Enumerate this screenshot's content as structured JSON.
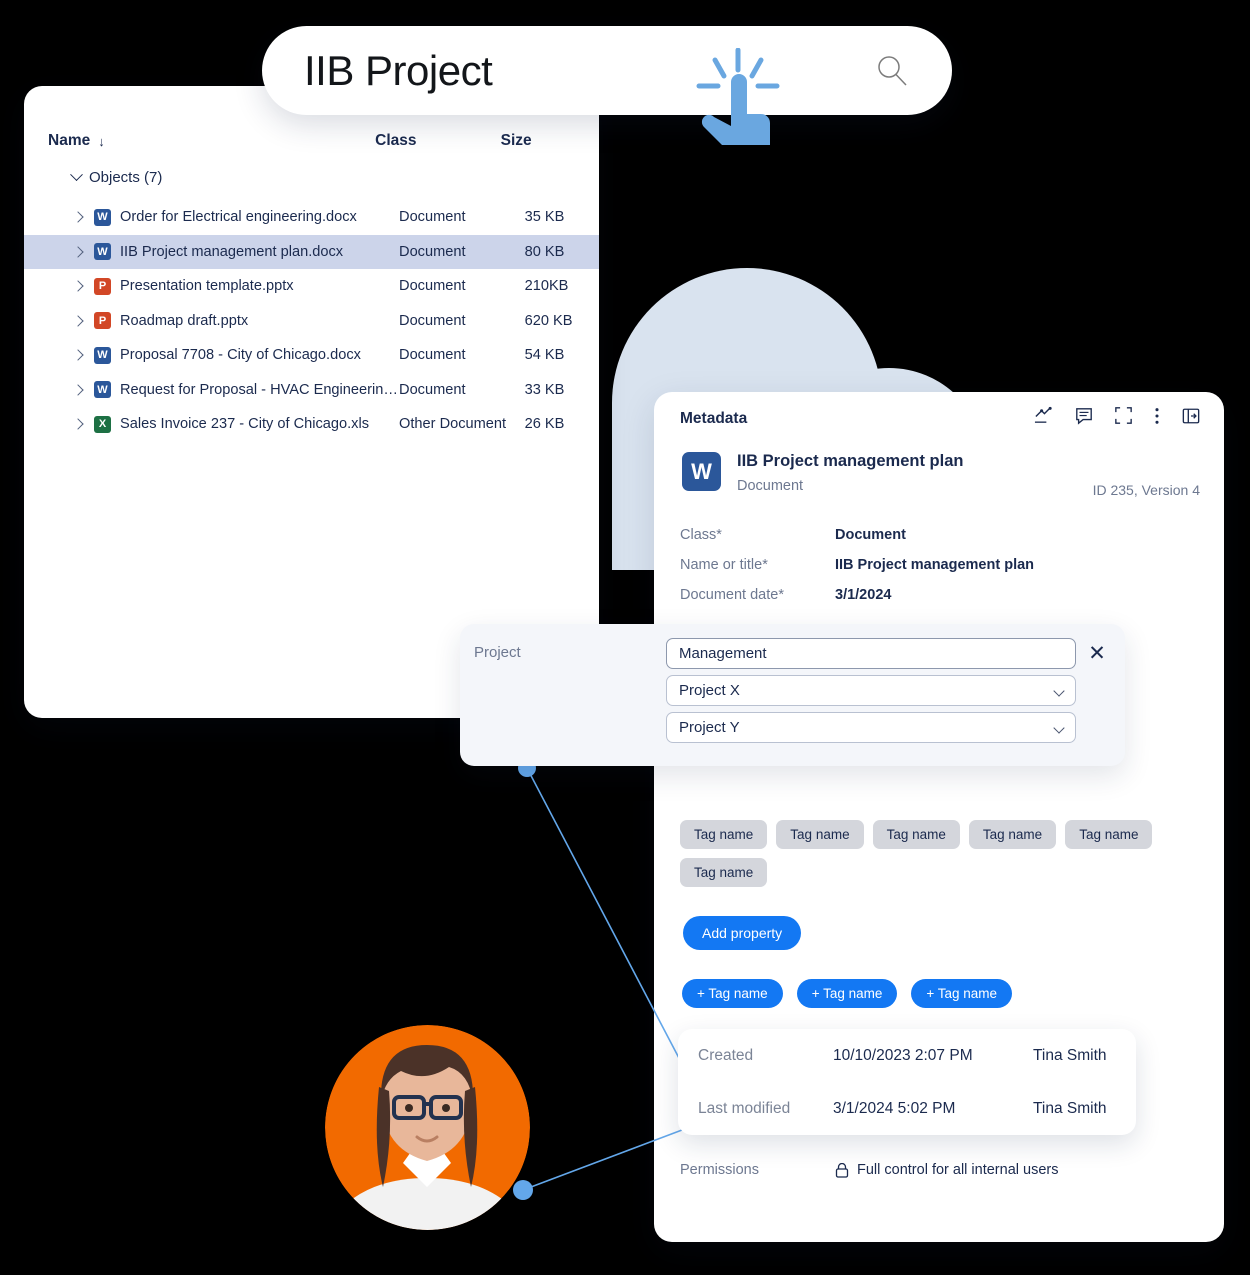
{
  "search": {
    "query": "IIB Project",
    "magnifier_icon": "search-icon",
    "cursor_icon": "click-cursor-icon"
  },
  "file_list": {
    "columns": {
      "name": "Name",
      "class": "Class",
      "size": "Size",
      "sort_arrow": "↓"
    },
    "group": {
      "label": "Objects (7)",
      "expand_icon": "chevron-down-icon"
    },
    "rows": [
      {
        "name": "Order for Electrical engineering.docx",
        "class": "Document",
        "size": "35 KB",
        "icon": "word-icon",
        "icon_letter": "W",
        "icon_type": "w",
        "selected": false
      },
      {
        "name": "IIB Project management plan.docx",
        "class": "Document",
        "size": "80 KB",
        "icon": "word-icon",
        "icon_letter": "W",
        "icon_type": "w",
        "selected": true
      },
      {
        "name": "Presentation template.pptx",
        "class": "Document",
        "size": "210KB",
        "icon": "powerpoint-icon",
        "icon_letter": "P",
        "icon_type": "p",
        "selected": false
      },
      {
        "name": "Roadmap draft.pptx",
        "class": "Document",
        "size": "620 KB",
        "icon": "powerpoint-icon",
        "icon_letter": "P",
        "icon_type": "p",
        "selected": false
      },
      {
        "name": "Proposal 7708 - City of Chicago.docx",
        "class": "Document",
        "size": "54 KB",
        "icon": "word-icon",
        "icon_letter": "W",
        "icon_type": "w",
        "selected": false
      },
      {
        "name": "Request for Proposal - HVAC Engineerin…",
        "class": "Document",
        "size": "33 KB",
        "icon": "word-icon",
        "icon_letter": "W",
        "icon_type": "w",
        "selected": false
      },
      {
        "name": "Sales Invoice 237 - City of Chicago.xls",
        "class": "Other Document",
        "size": "26 KB",
        "icon": "excel-icon",
        "icon_letter": "X",
        "icon_type": "x",
        "selected": false
      }
    ]
  },
  "metadata": {
    "panel_title": "Metadata",
    "toolbar_icons": [
      "workflow-icon",
      "comment-icon",
      "expand-icon",
      "more-vertical-icon",
      "collapse-panel-icon"
    ],
    "document": {
      "icon": "word-icon",
      "icon_letter": "W",
      "title": "IIB Project management plan",
      "subtitle": "Document",
      "id_version": "ID 235, Version 4"
    },
    "properties": [
      {
        "label": "Class*",
        "value": "Document"
      },
      {
        "label": "Name or title*",
        "value": "IIB Project management plan"
      },
      {
        "label": "Document date*",
        "value": "3/1/2024"
      }
    ],
    "tags": [
      "Tag name",
      "Tag name",
      "Tag name",
      "Tag name",
      "Tag name",
      "Tag name"
    ],
    "add_property_label": "Add property",
    "add_tags": [
      "+ Tag name",
      "+ Tag name",
      "+ Tag name"
    ],
    "stamps": [
      {
        "label": "Created",
        "date": "10/10/2023 2:07 PM",
        "user": "Tina Smith"
      },
      {
        "label": "Last modified",
        "date": "3/1/2024 5:02 PM",
        "user": "Tina Smith"
      }
    ],
    "permissions": {
      "label": "Permissions",
      "value": "Full control for all internal users",
      "icon": "lock-icon"
    }
  },
  "project_panel": {
    "label": "Project",
    "close_icon": "close-icon",
    "fields": [
      {
        "value": "Management",
        "has_chevron": false
      },
      {
        "value": "Project X",
        "has_chevron": true
      },
      {
        "value": "Project Y",
        "has_chevron": true
      }
    ]
  },
  "colors": {
    "accent_blue": "#1378f3",
    "selected_row": "#ccd4ea",
    "cloud": "#d9e3ef",
    "avatar_ring": "#f26a00",
    "word": "#2b579a",
    "powerpoint": "#d24726",
    "excel": "#1d7044",
    "connector": "#63a7ea"
  }
}
